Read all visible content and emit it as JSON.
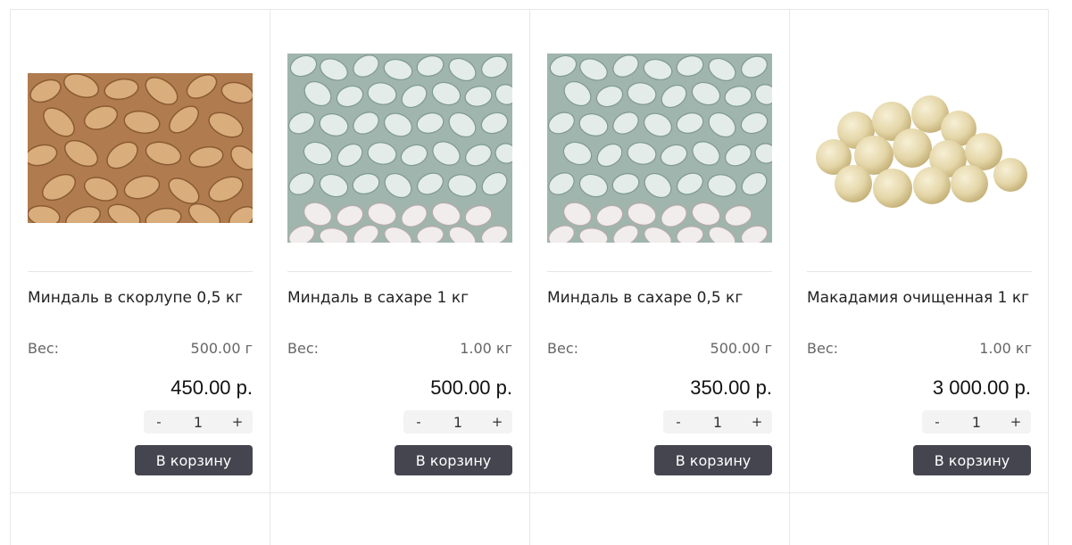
{
  "products": [
    {
      "image": "almonds-in-shell-photo",
      "title": "Миндаль в скорлупе 0,5 кг",
      "weight_label": "Вес:",
      "weight_value": "500.00 г",
      "price": "450.00 р.",
      "minus": "-",
      "qty": "1",
      "plus": "+",
      "button": "В корзину"
    },
    {
      "image": "sugar-almonds-photo",
      "title": "Миндаль в сахаре 1 кг",
      "weight_label": "Вес:",
      "weight_value": "1.00 кг",
      "price": "500.00 р.",
      "minus": "-",
      "qty": "1",
      "plus": "+",
      "button": "В корзину"
    },
    {
      "image": "sugar-almonds-photo",
      "title": "Миндаль в сахаре 0,5 кг",
      "weight_label": "Вес:",
      "weight_value": "500.00 г",
      "price": "350.00 р.",
      "minus": "-",
      "qty": "1",
      "plus": "+",
      "button": "В корзину"
    },
    {
      "image": "macadamia-photo",
      "title": "Макадамия очищенная 1 кг",
      "weight_label": "Вес:",
      "weight_value": "1.00 кг",
      "price": "3 000.00 р.",
      "minus": "-",
      "qty": "1",
      "plus": "+",
      "button": "В корзину"
    }
  ],
  "colors": {
    "button_bg": "#454550",
    "button_text": "#ffffff",
    "stepper_bg": "#f3f3f3",
    "border": "#e8e8e8"
  }
}
